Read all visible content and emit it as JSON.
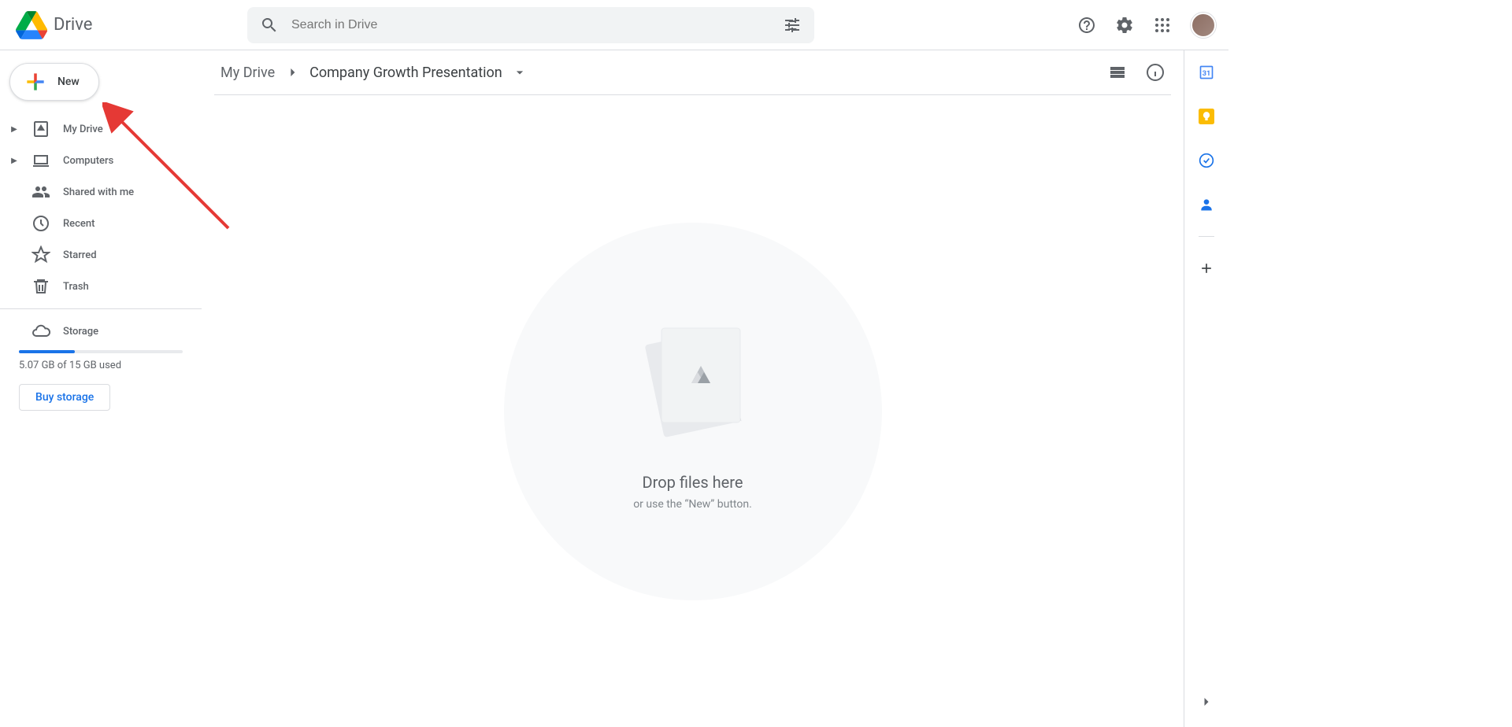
{
  "app": {
    "name": "Drive"
  },
  "search": {
    "placeholder": "Search in Drive"
  },
  "sidebar": {
    "new_label": "New",
    "items": [
      {
        "label": "My Drive",
        "expandable": true
      },
      {
        "label": "Computers",
        "expandable": true
      },
      {
        "label": "Shared with me",
        "expandable": false
      },
      {
        "label": "Recent",
        "expandable": false
      },
      {
        "label": "Starred",
        "expandable": false
      },
      {
        "label": "Trash",
        "expandable": false
      }
    ],
    "storage_label": "Storage",
    "storage_used_text": "5.07 GB of 15 GB used",
    "storage_percent": 34,
    "buy_label": "Buy storage"
  },
  "breadcrumb": {
    "root": "My Drive",
    "current": "Company Growth Presentation"
  },
  "empty": {
    "title": "Drop files here",
    "subtitle": "or use the “New” button."
  }
}
